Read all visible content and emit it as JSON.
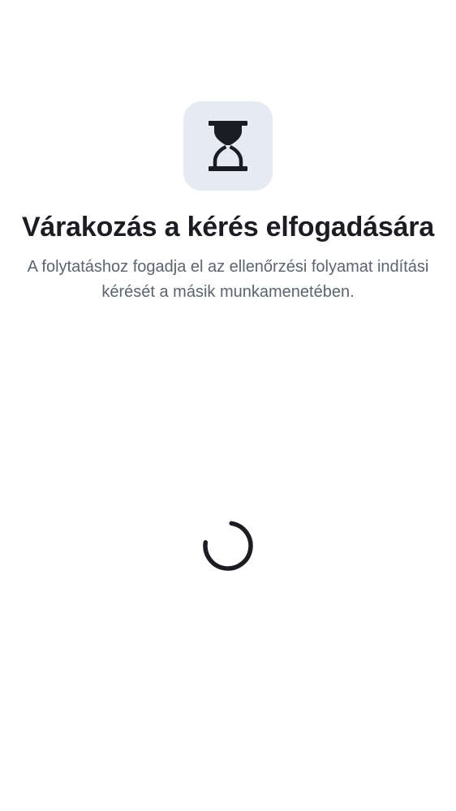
{
  "status_icon": {
    "icon": "hourglass-icon"
  },
  "heading": {
    "title": "Várakozás a kérés elfogadására",
    "description": "A folytatáshoz fogadja el az ellenőrzési folyamat indítási kérését a másik munkamenetében."
  },
  "progress": {
    "icon": "loading-spinner"
  },
  "colors": {
    "background": "#ffffff",
    "tile": "#e6eaf2",
    "title": "#1b1d22",
    "description": "#5d636f",
    "icon": "#1b1d22"
  }
}
